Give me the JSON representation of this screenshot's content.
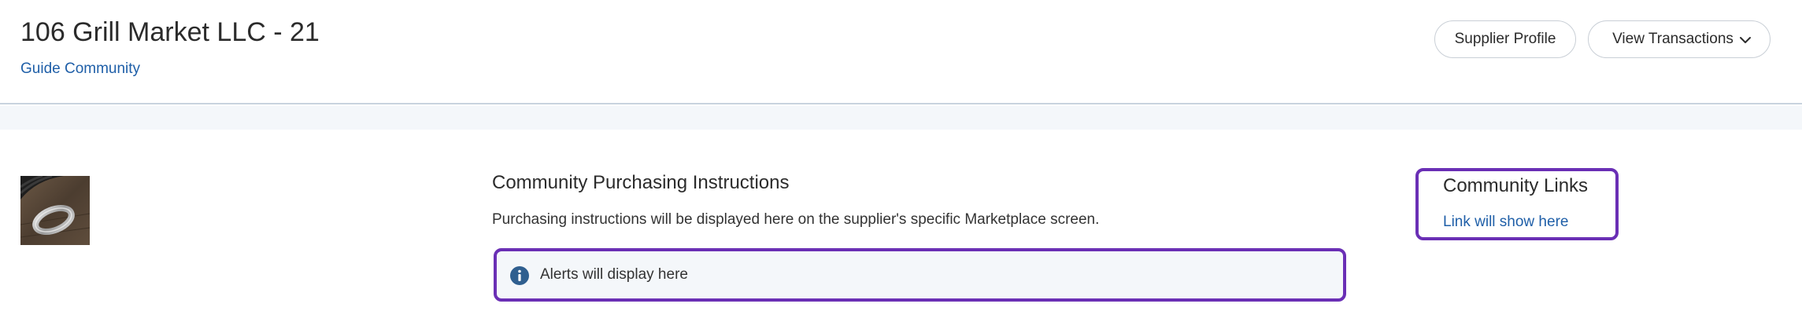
{
  "header": {
    "title": "106 Grill Market LLC - 21",
    "guide_link": "Guide Community",
    "buttons": {
      "supplier_profile": "Supplier Profile",
      "view_transactions": "View Transactions"
    }
  },
  "main": {
    "logo_alt": "Supplier logo",
    "instructions": {
      "heading": "Community Purchasing Instructions",
      "text": "Purchasing instructions will be displayed here on the supplier's specific Marketplace screen.",
      "alert": "Alerts will display here"
    },
    "community_links": {
      "heading": "Community Links",
      "link": "Link will show here"
    }
  },
  "colors": {
    "link": "#1f5fa8",
    "highlight_border": "#6a2fb5",
    "band": "#f4f7fa",
    "info_icon": "#2f5f8f"
  },
  "icons": {
    "dropdown": "chevron-down-icon",
    "alert": "info-icon"
  }
}
